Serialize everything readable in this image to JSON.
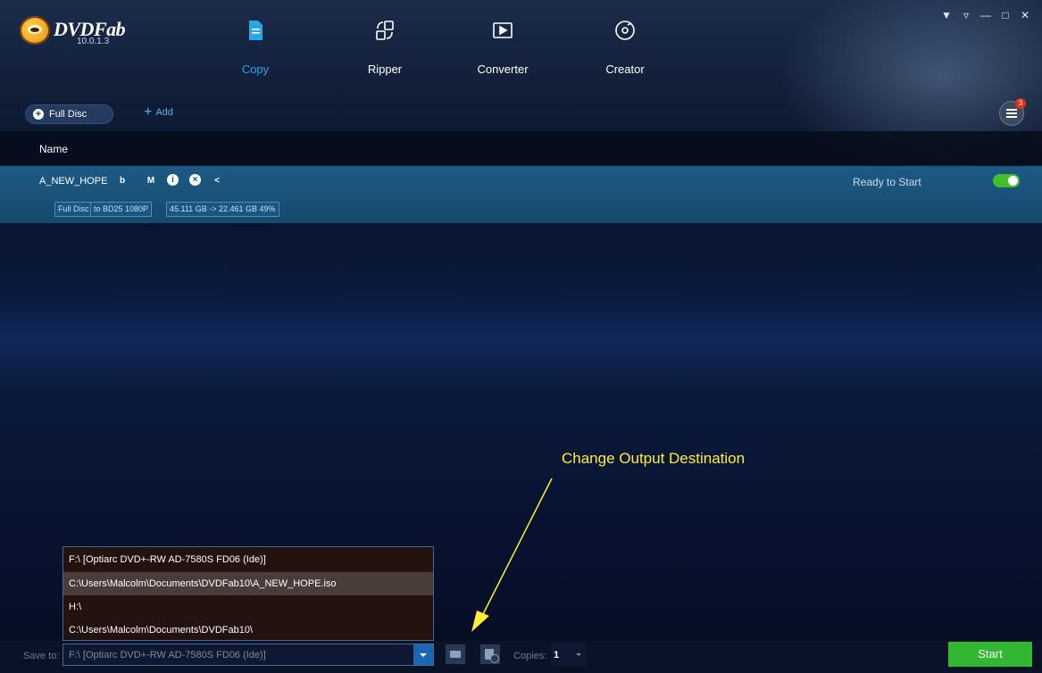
{
  "app": {
    "brand": "DVDFab",
    "version": "10.0.1.3"
  },
  "modules": [
    {
      "label": "Copy",
      "icon": "document-icon",
      "active": true
    },
    {
      "label": "Ripper",
      "icon": "ripper-icon",
      "active": false
    },
    {
      "label": "Converter",
      "icon": "film-icon",
      "active": false
    },
    {
      "label": "Creator",
      "icon": "disc-icon",
      "active": false
    }
  ],
  "toolbar": {
    "full_disc_label": "Full Disc",
    "add_label": "Add",
    "queue_badge": "3"
  },
  "list": {
    "header_name": "Name",
    "task": {
      "title": "A_NEW_HOPE",
      "icons": [
        "bluray-icon",
        "menu-m-icon",
        "info-icon",
        "close-icon",
        "share-icon"
      ],
      "icon_glyphs": [
        "b",
        "M",
        "i",
        "×",
        "<"
      ],
      "tags": [
        "Full Disc",
        "to BD25 1080P",
        "45.111 GB -> 22.461 GB 49%"
      ],
      "status": "Ready to Start",
      "enabled": true
    }
  },
  "annotation": {
    "text": "Change Output Destination",
    "color": "#ffee33"
  },
  "save_dropdown": {
    "options": [
      "F:\\ [Optiarc DVD+-RW AD-7580S FD06 (Ide)]",
      "C:\\Users\\Malcolm\\Documents\\DVDFab10\\A_NEW_HOPE.iso",
      "H:\\",
      "C:\\Users\\Malcolm\\Documents\\DVDFab10\\"
    ],
    "hovered_index": 1
  },
  "bottom": {
    "save_label": "Save to:",
    "save_value": "F:\\ [Optiarc DVD+-RW AD-7580S FD06 (Ide)]",
    "copies_label": "Copies:",
    "copies_value": "1",
    "start_label": "Start"
  },
  "colors": {
    "accent": "#2aa6e6",
    "start": "#32b732",
    "toggle": "#41c02a",
    "badge": "#e0301e"
  }
}
